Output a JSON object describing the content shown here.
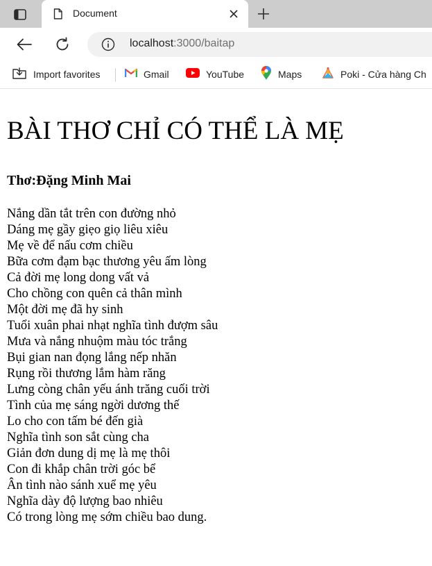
{
  "browser": {
    "tab": {
      "title": "Document"
    },
    "address": {
      "host": "localhost",
      "rest": ":3000/baitap"
    },
    "favorites": [
      {
        "label": "Import favorites",
        "icon": "import-favorites-icon"
      },
      {
        "label": "Gmail",
        "icon": "gmail-icon"
      },
      {
        "label": "YouTube",
        "icon": "youtube-icon"
      },
      {
        "label": "Maps",
        "icon": "maps-icon"
      },
      {
        "label": "Poki - Cửa hàng Ch",
        "icon": "poki-icon"
      }
    ],
    "colors": {
      "tabstrip": "#cdcdcd",
      "omnibox": "#f1f1f1",
      "youtube_red": "#ff0000"
    }
  },
  "page": {
    "title": "BÀI THƠ CHỈ CÓ THỂ LÀ MẸ",
    "author": "Thơ:Đặng Minh Mai",
    "lines": [
      "Nắng dần tắt trên con đường nhỏ",
      "Dáng mẹ gầy giẹo giọ liêu xiêu",
      "Mẹ về để nấu cơm chiều",
      "Bữa cơm đạm bạc thương yêu ấm lòng",
      "Cả đời mẹ long dong vất vả",
      "Cho chồng con quên cả thân mình",
      "Một đời mẹ đã hy sinh",
      "Tuổi xuân phai nhạt nghĩa tình đượm sâu",
      "Mưa và nắng nhuộm màu tóc trắng",
      "Bụi gian nan đọng lắng nếp nhăn",
      "Rụng rồi thương lắm hàm răng",
      "Lưng còng chân yếu ánh trăng cuối trời",
      "Tình của mẹ sáng ngời dương thế",
      "Lo cho con tấm bé đến già",
      "Nghĩa tình son sắt cùng cha",
      "Giản đơn dung dị mẹ là mẹ thôi",
      "Con đi khắp chân trời góc bể",
      "Ân tình nào sánh xuể mẹ yêu",
      "Nghĩa dày độ lượng bao nhiêu",
      "Có trong lòng mẹ sớm chiều bao dung."
    ]
  }
}
